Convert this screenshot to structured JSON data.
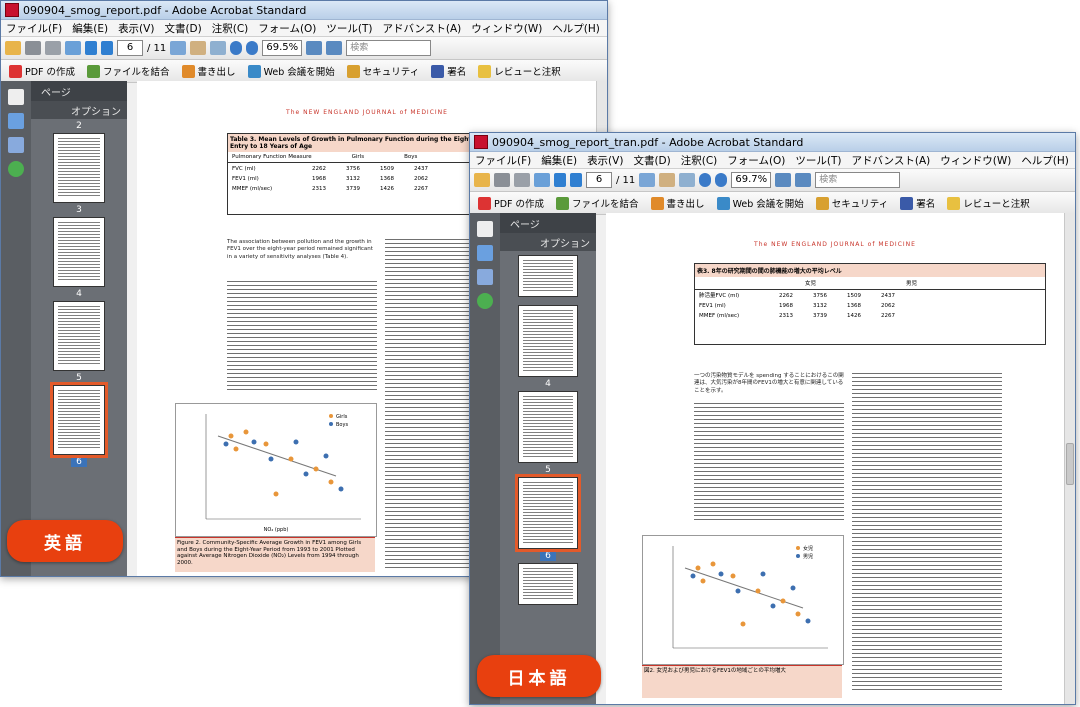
{
  "en_window": {
    "title": "090904_smog_report.pdf - Adobe Acrobat Standard",
    "menu": [
      "ファイル(F)",
      "編集(E)",
      "表示(V)",
      "文書(D)",
      "注釈(C)",
      "フォーム(O)",
      "ツール(T)",
      "アドバンスト(A)",
      "ウィンドウ(W)",
      "ヘルプ(H)"
    ],
    "page_current": "6",
    "page_total": "/ 11",
    "zoom": "69.5%",
    "search_placeholder": "検索",
    "tasks": [
      "PDF の作成",
      "ファイルを結合",
      "書き出し",
      "Web 会議を開始",
      "セキュリティ",
      "署名",
      "レビューと注釈"
    ],
    "panel_title": "ページ",
    "panel_options": "オプション",
    "thumb_labels": [
      "2",
      "3",
      "4",
      "5",
      "6"
    ],
    "journal_header": "The NEW ENGLAND JOURNAL of MEDICINE",
    "table_caption": "Table 3. Mean Levels of Growth in Pulmonary Function during the Eight-Year Study Period, from Study Entry to 18 Years of Age",
    "table_cols": [
      "Pulmonary Function Measure",
      "Girls",
      "Boys"
    ],
    "table_rows": [
      [
        "FVC (ml)",
        "2262",
        "3756",
        "1509",
        "2437"
      ],
      [
        "FEV1 (ml)",
        "1968",
        "3132",
        "1368",
        "2062"
      ],
      [
        "MMEF (ml/sec)",
        "2313",
        "3739",
        "1426",
        "2267"
      ]
    ],
    "body_paragraph": "The association between pollution and the growth in FEV1 over the eight-year period remained significant in a variety of sensitivity analyses (Table 4).",
    "chart_legend": [
      "Girls",
      "Boys"
    ],
    "chart_xlabel": "NO₂ (ppb)",
    "figure_caption": "Figure 2. Community-Specific Average Growth in FEV1 among Girls and Boys during the Eight-Year Period from 1993 to 2001 Plotted against Average Nitrogen Dioxide (NO₂) Levels from 1994 through 2000."
  },
  "ja_window": {
    "title": "090904_smog_report_tran.pdf - Adobe Acrobat Standard",
    "menu": [
      "ファイル(F)",
      "編集(E)",
      "表示(V)",
      "文書(D)",
      "注釈(C)",
      "フォーム(O)",
      "ツール(T)",
      "アドバンスト(A)",
      "ウィンドウ(W)",
      "ヘルプ(H)"
    ],
    "page_current": "6",
    "page_total": "/ 11",
    "zoom": "69.7%",
    "search_placeholder": "検索",
    "tasks": [
      "PDF の作成",
      "ファイルを結合",
      "書き出し",
      "Web 会議を開始",
      "セキュリティ",
      "署名",
      "レビューと注釈"
    ],
    "panel_title": "ページ",
    "panel_options": "オプション",
    "thumb_labels": [
      "4",
      "5",
      "6"
    ],
    "journal_header": "The NEW ENGLAND JOURNAL of MEDICINE",
    "table_caption": "表3. 8年の研究期間の間の肺機能の増大の平均レベル",
    "table_cols": [
      "女児",
      "男児"
    ],
    "table_rows": [
      [
        "肺活量FVC (ml)",
        "2262",
        "3756",
        "1509",
        "2437"
      ],
      [
        "FEV1 (ml)",
        "1968",
        "3132",
        "1368",
        "2062"
      ],
      [
        "MMEF (ml/sec)",
        "2313",
        "3739",
        "1426",
        "2267"
      ]
    ],
    "body_paragraph": "一つの汚染物質モデルを spending することにおけるこの関連は、大気汚染が8年間のFEV1の増大と有意に関連していることを示す。",
    "chart_legend": [
      "女児",
      "男児"
    ],
    "figure_caption": "図2. 女児および男児におけるFEV1の地域ごとの平均増大"
  },
  "badges": {
    "english": "英語",
    "japanese": "日本語"
  },
  "colors": {
    "badge": "#e8400f",
    "accent_red": "#c8342a",
    "girls": "#e8963a",
    "boys": "#3d6fb0"
  }
}
